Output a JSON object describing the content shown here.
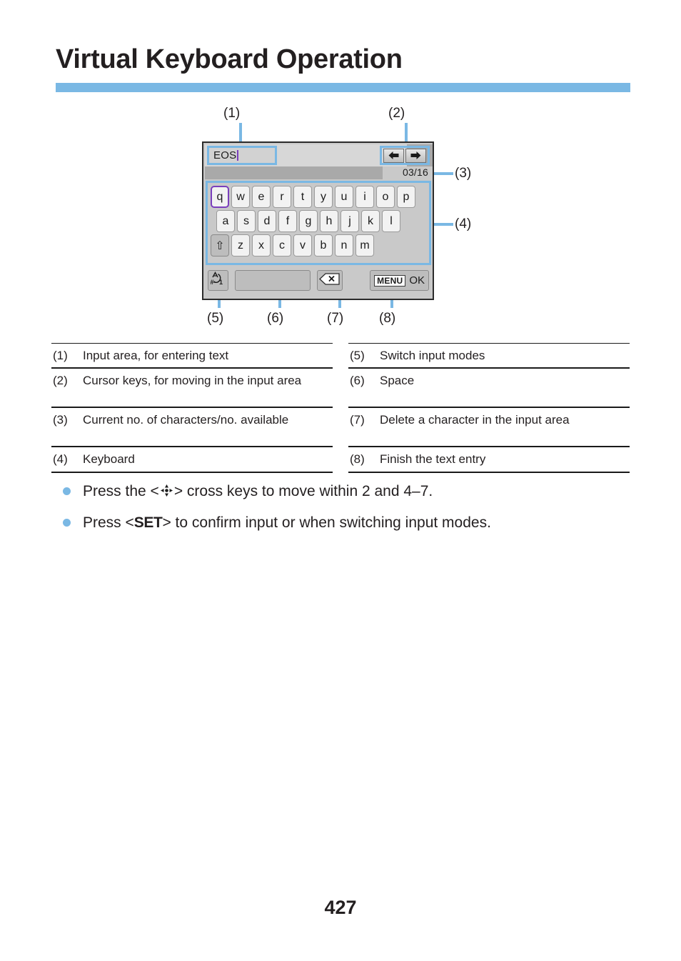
{
  "page": {
    "title": "Virtual Keyboard Operation",
    "number": "427",
    "accent_color": "#7ab8e4"
  },
  "figure": {
    "callouts": [
      {
        "id": "1",
        "label": "(1)"
      },
      {
        "id": "2",
        "label": "(2)"
      },
      {
        "id": "3",
        "label": "(3)"
      },
      {
        "id": "4",
        "label": "(4)"
      },
      {
        "id": "5",
        "label": "(5)"
      },
      {
        "id": "6",
        "label": "(6)"
      },
      {
        "id": "7",
        "label": "(7)"
      },
      {
        "id": "8",
        "label": "(8)"
      }
    ],
    "input_area": {
      "value": "EOS",
      "caret_color": "#7a3fbd"
    },
    "cursor_keys": {
      "left_icon": "arrow-left-icon",
      "right_icon": "arrow-right-icon"
    },
    "char_count": "03/16",
    "keyboard": {
      "row1": [
        "q",
        "w",
        "e",
        "r",
        "t",
        "y",
        "u",
        "i",
        "o",
        "p"
      ],
      "row2": [
        "a",
        "s",
        "d",
        "f",
        "g",
        "h",
        "j",
        "k",
        "l"
      ],
      "row3_shift": "⇧",
      "row3": [
        "z",
        "x",
        "c",
        "v",
        "b",
        "n",
        "m"
      ],
      "selected_key": "q",
      "selection_color": "#7a3fbd"
    },
    "function_row": {
      "mode_icon": "input-mode-switch-icon",
      "space_label": "",
      "delete_icon": "backspace-delete-icon",
      "menu_badge": "MENU",
      "ok_label": "OK"
    }
  },
  "descriptions": {
    "left": [
      {
        "num": "(1)",
        "text": "Input area, for entering text"
      },
      {
        "num": "(2)",
        "text": "Cursor keys, for moving in the input area"
      },
      {
        "num": "(3)",
        "text": "Current no. of characters/no. available"
      },
      {
        "num": "(4)",
        "text": "Keyboard"
      }
    ],
    "right": [
      {
        "num": "(5)",
        "text": "Switch input modes"
      },
      {
        "num": "(6)",
        "text": "Space"
      },
      {
        "num": "(7)",
        "text": "Delete a character in the input area"
      },
      {
        "num": "(8)",
        "text": "Finish the text entry"
      }
    ]
  },
  "notes": [
    {
      "before": "Press the <",
      "glyph": "cross-keys-icon",
      "after": "> cross keys to move within 2 and 4–7."
    },
    {
      "before": "Press <",
      "glyph": "SET",
      "after": "> to confirm input or when switching input modes."
    }
  ]
}
